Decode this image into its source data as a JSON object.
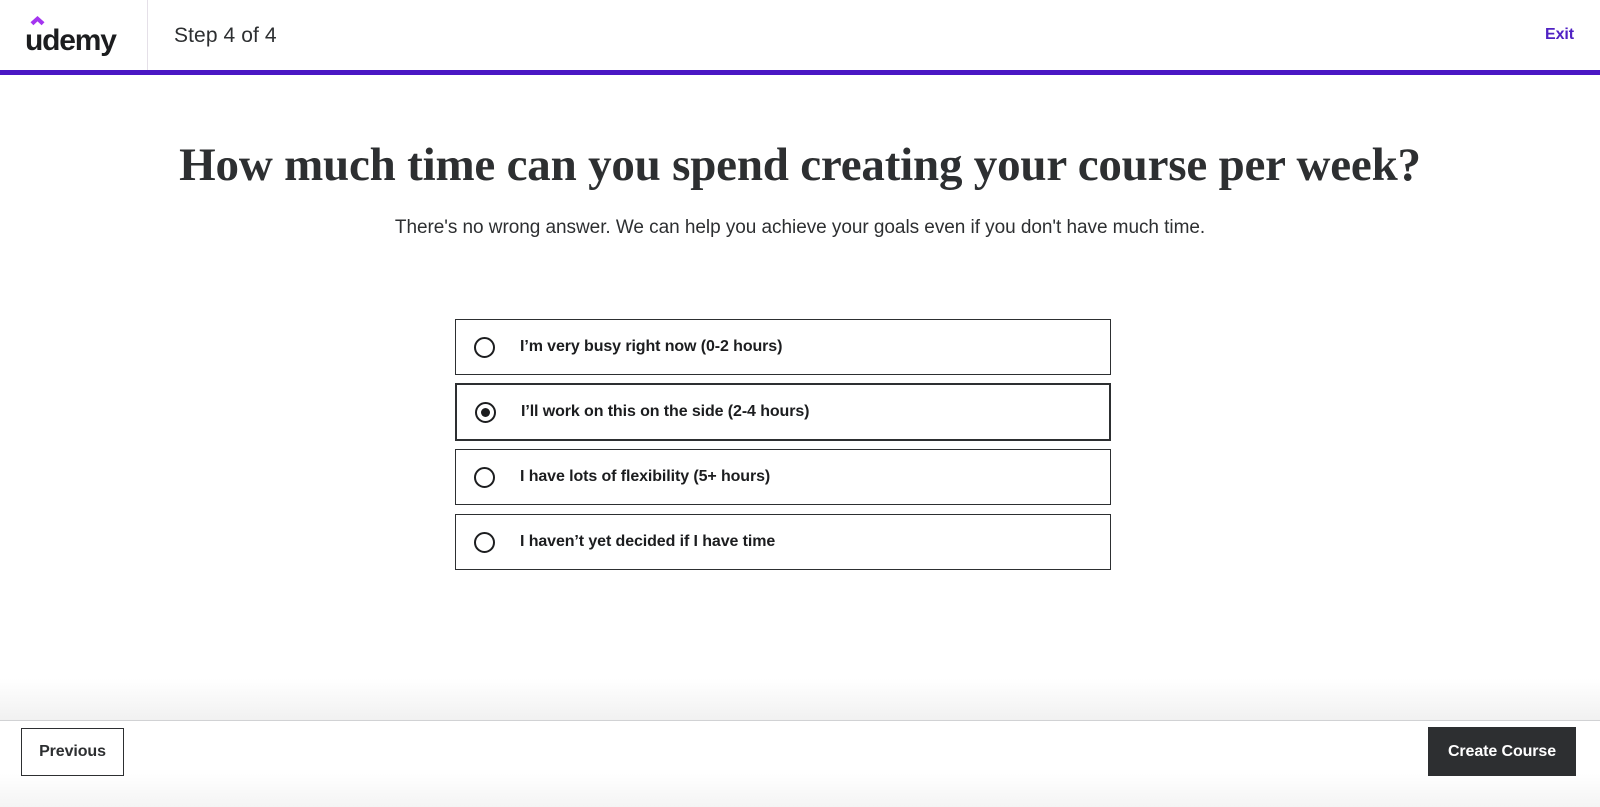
{
  "header": {
    "logo_text": "udemy",
    "logo_caret_color": "#A435F0",
    "step_label": "Step 4 of 4",
    "exit_label": "Exit",
    "accent_color": "#4A17C4"
  },
  "main": {
    "heading": "How much time can you spend creating your course per week?",
    "subheading": "There's no wrong answer. We can help you achieve your goals even if you don't have much time.",
    "options": [
      {
        "label": "I’m very busy right now (0-2 hours)",
        "selected": false
      },
      {
        "label": "I’ll work on this on the side (2-4 hours)",
        "selected": true
      },
      {
        "label": "I have lots of flexibility (5+ hours)",
        "selected": false
      },
      {
        "label": "I haven’t yet decided if I have time",
        "selected": false
      }
    ]
  },
  "footer": {
    "previous_label": "Previous",
    "create_label": "Create Course",
    "create_bg": "#2D2F31"
  }
}
